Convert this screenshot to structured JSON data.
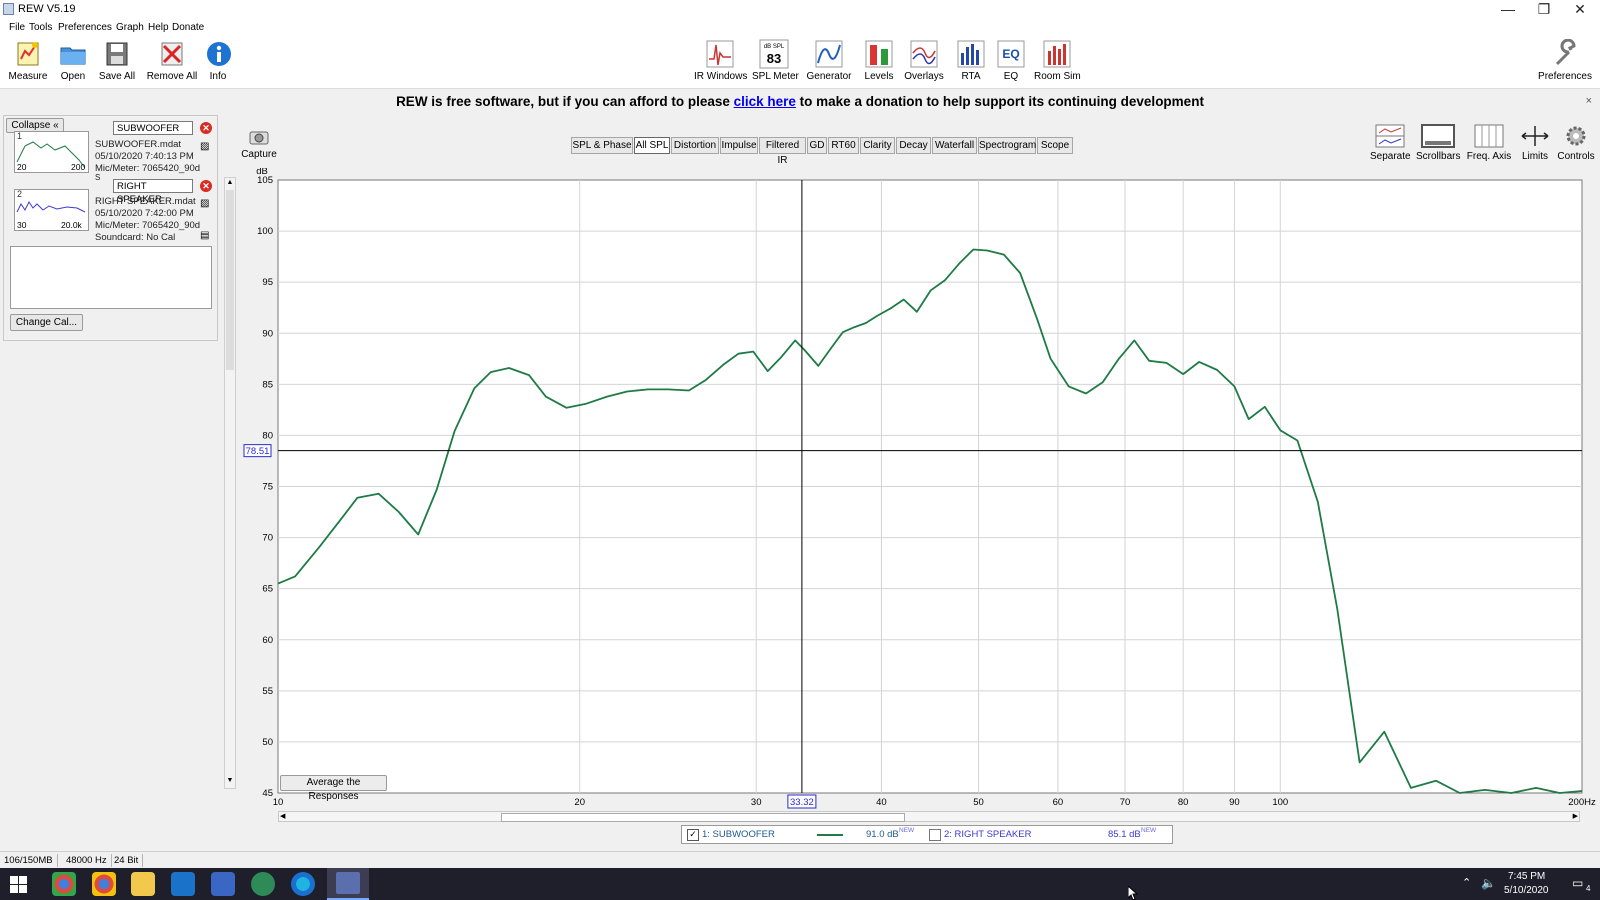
{
  "window": {
    "title": "REW V5.19",
    "min": "—",
    "max": "❐",
    "close": "✕"
  },
  "menu": [
    "File",
    "Tools",
    "Preferences",
    "Graph",
    "Help",
    "Donate"
  ],
  "toolbar_left": [
    {
      "label": "Measure",
      "icon": "measure-icon"
    },
    {
      "label": "Open",
      "icon": "folder-icon"
    },
    {
      "label": "Save All",
      "icon": "save-icon"
    },
    {
      "label": "Remove All",
      "icon": "remove-icon"
    },
    {
      "label": "Info",
      "icon": "info-icon"
    }
  ],
  "toolbar_center": [
    {
      "label": "IR Windows",
      "icon": "ir-windows-icon"
    },
    {
      "label": "SPL Meter",
      "icon": "spl-meter-icon",
      "meter_caption": "dB SPL",
      "meter_value": "83"
    },
    {
      "label": "Generator",
      "icon": "generator-icon"
    },
    {
      "label": "Levels",
      "icon": "levels-icon"
    },
    {
      "label": "Overlays",
      "icon": "overlays-icon"
    },
    {
      "label": "RTA",
      "icon": "rta-icon"
    },
    {
      "label": "EQ",
      "icon": "eq-icon",
      "icon_text": "EQ"
    },
    {
      "label": "Room Sim",
      "icon": "room-sim-icon"
    }
  ],
  "toolbar_right": {
    "label": "Preferences",
    "icon": "wrench-icon"
  },
  "banner": {
    "before": "REW is free software, but if you can afford to please ",
    "link": "click here",
    "after": " to make a donation to help support its continuing development",
    "close": "×"
  },
  "panel": {
    "collapse_label": "Collapse",
    "change_cal_label": "Change Cal...",
    "measurements": [
      {
        "num": "1",
        "name": "SUBWOOFER",
        "file": "SUBWOOFER.mdat",
        "date": "05/10/2020 7:40:13 PM",
        "mic": "Mic/Meter: 7065420_90d",
        "extra": "S",
        "thumb_lo": "20",
        "thumb_hi": "200",
        "color": "#1e7b45"
      },
      {
        "num": "2",
        "name": "RIGHT SPEAKER",
        "file": "RIGHT SPEAKER.mdat",
        "date": "05/10/2020 7:42:00 PM",
        "mic": "Mic/Meter: 7065420_90d",
        "extra": "Soundcard: No Cal",
        "thumb_lo": "30",
        "thumb_hi": "20.0k",
        "color": "#3b3bd6"
      }
    ]
  },
  "capture_label": "Capture",
  "graph_tabs": [
    "SPL & Phase",
    "All SPL",
    "Distortion",
    "Impulse",
    "Filtered IR",
    "GD",
    "RT60",
    "Clarity",
    "Decay",
    "Waterfall",
    "Spectrogram",
    "Scope"
  ],
  "graph_tab_selected": "All SPL",
  "graph_tools": [
    {
      "label": "Separate",
      "icon": "separate-icon"
    },
    {
      "label": "Scrollbars",
      "icon": "scrollbars-icon"
    },
    {
      "label": "Freq. Axis",
      "icon": "freq-axis-icon"
    },
    {
      "label": "Limits",
      "icon": "limits-icon"
    },
    {
      "label": "Controls",
      "icon": "gear-icon"
    }
  ],
  "average_button": "Average the Responses",
  "chart_data": {
    "type": "line",
    "xlabel": "Hz",
    "ylabel": "dB",
    "x_scale": "log",
    "xlim": [
      10,
      200
    ],
    "ylim": [
      45,
      105
    ],
    "x_ticks": [
      10,
      20,
      30,
      40,
      50,
      60,
      70,
      80,
      90,
      100,
      200
    ],
    "x_tick_labels": [
      "10",
      "20",
      "30",
      "40",
      "50",
      "60",
      "70",
      "80",
      "90",
      "100",
      "200Hz"
    ],
    "y_ticks": [
      45,
      50,
      55,
      60,
      65,
      70,
      75,
      80,
      85,
      90,
      95,
      100,
      105
    ],
    "grid": true,
    "cursor": {
      "x": 33.32,
      "y": 78.51,
      "x_label": "33.32",
      "y_label": "78.51"
    },
    "series": [
      {
        "name": "1: SUBWOOFER",
        "color": "#1e7b45",
        "x": [
          10,
          10.4,
          11,
          11.6,
          12,
          12.6,
          13.2,
          13.8,
          14.4,
          15,
          15.7,
          16.3,
          17,
          17.8,
          18.5,
          19.4,
          20.3,
          21.3,
          22.3,
          23.4,
          24.5,
          25.7,
          26.7,
          27.8,
          28.8,
          29.8,
          30.8,
          31.8,
          32.8,
          33.5,
          34.6,
          35.6,
          36.6,
          37.6,
          38.6,
          39.6,
          40.8,
          42.1,
          43.4,
          44.8,
          46.3,
          47.8,
          49.4,
          51,
          53,
          55,
          57.2,
          59,
          61.5,
          64,
          66.5,
          69,
          71.5,
          74,
          77,
          80,
          83,
          86.5,
          90,
          93,
          96.5,
          100,
          104,
          109,
          114,
          120,
          127,
          135,
          143,
          151,
          160,
          170,
          180,
          190,
          200
        ],
        "y": [
          65.5,
          66.2,
          69.1,
          72,
          73.9,
          74.3,
          72.5,
          70.3,
          74.7,
          80.4,
          84.6,
          86.2,
          86.6,
          85.9,
          83.8,
          82.7,
          83.1,
          83.8,
          84.3,
          84.5,
          84.5,
          84.4,
          85.4,
          86.9,
          88,
          88.2,
          86.3,
          87.7,
          89.3,
          88.4,
          86.8,
          88.5,
          90.1,
          90.6,
          91,
          91.7,
          92.4,
          93.3,
          92.1,
          94.2,
          95.2,
          96.8,
          98.2,
          98.1,
          97.7,
          95.9,
          91.4,
          87.5,
          84.8,
          84.1,
          85.2,
          87.5,
          89.3,
          87.3,
          87.1,
          86,
          87.2,
          86.4,
          84.8,
          81.6,
          82.8,
          80.5,
          79.5,
          73.5,
          63,
          48,
          51,
          45.5,
          46.2,
          45,
          45.3,
          45,
          45.5,
          45,
          45.2
        ]
      }
    ]
  },
  "legend": {
    "s1_label": "1: SUBWOOFER",
    "s1_value": "91.0 dB",
    "s1_tag": "NEW",
    "s1_checked": true,
    "s2_label": "2: RIGHT SPEAKER",
    "s2_value": "85.1 dB",
    "s2_tag": "NEW",
    "s2_checked": false
  },
  "status": {
    "memory": "106/150MB",
    "rate": "48000 Hz",
    "bits": "24 Bit"
  },
  "taskbar": {
    "time": "7:45 PM",
    "date": "5/10/2020",
    "notify_count": "4"
  }
}
